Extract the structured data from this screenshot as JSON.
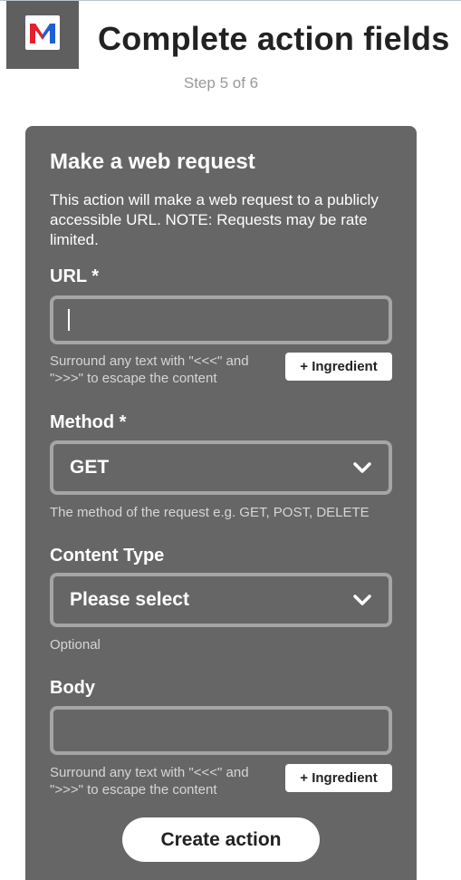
{
  "header": {
    "logo_name": "M-logo",
    "title": "Complete action fields",
    "step": "Step 5 of 6"
  },
  "action": {
    "title": "Make a web request",
    "description": "This action will make a web request to a publicly accessible URL. NOTE: Requests may be rate limited."
  },
  "fields": {
    "url": {
      "label": "URL *",
      "value": "",
      "helper": "Surround any text with \"<<<\" and \">>>\" to escape the content",
      "ingredient_label": "+ Ingredient"
    },
    "method": {
      "label": "Method *",
      "selected": "GET",
      "helper": "The method of the request e.g. GET, POST, DELETE"
    },
    "content_type": {
      "label": "Content Type",
      "selected": "Please select",
      "helper": "Optional"
    },
    "body": {
      "label": "Body",
      "value": "",
      "helper": "Surround any text with \"<<<\" and \">>>\" to escape the content",
      "ingredient_label": "+ Ingredient"
    }
  },
  "submit_label": "Create action",
  "colors": {
    "card_background": "#666666",
    "logo_background": "#5f5f5f",
    "logo_red": "#e5202e",
    "logo_blue": "#1f5fd6"
  }
}
